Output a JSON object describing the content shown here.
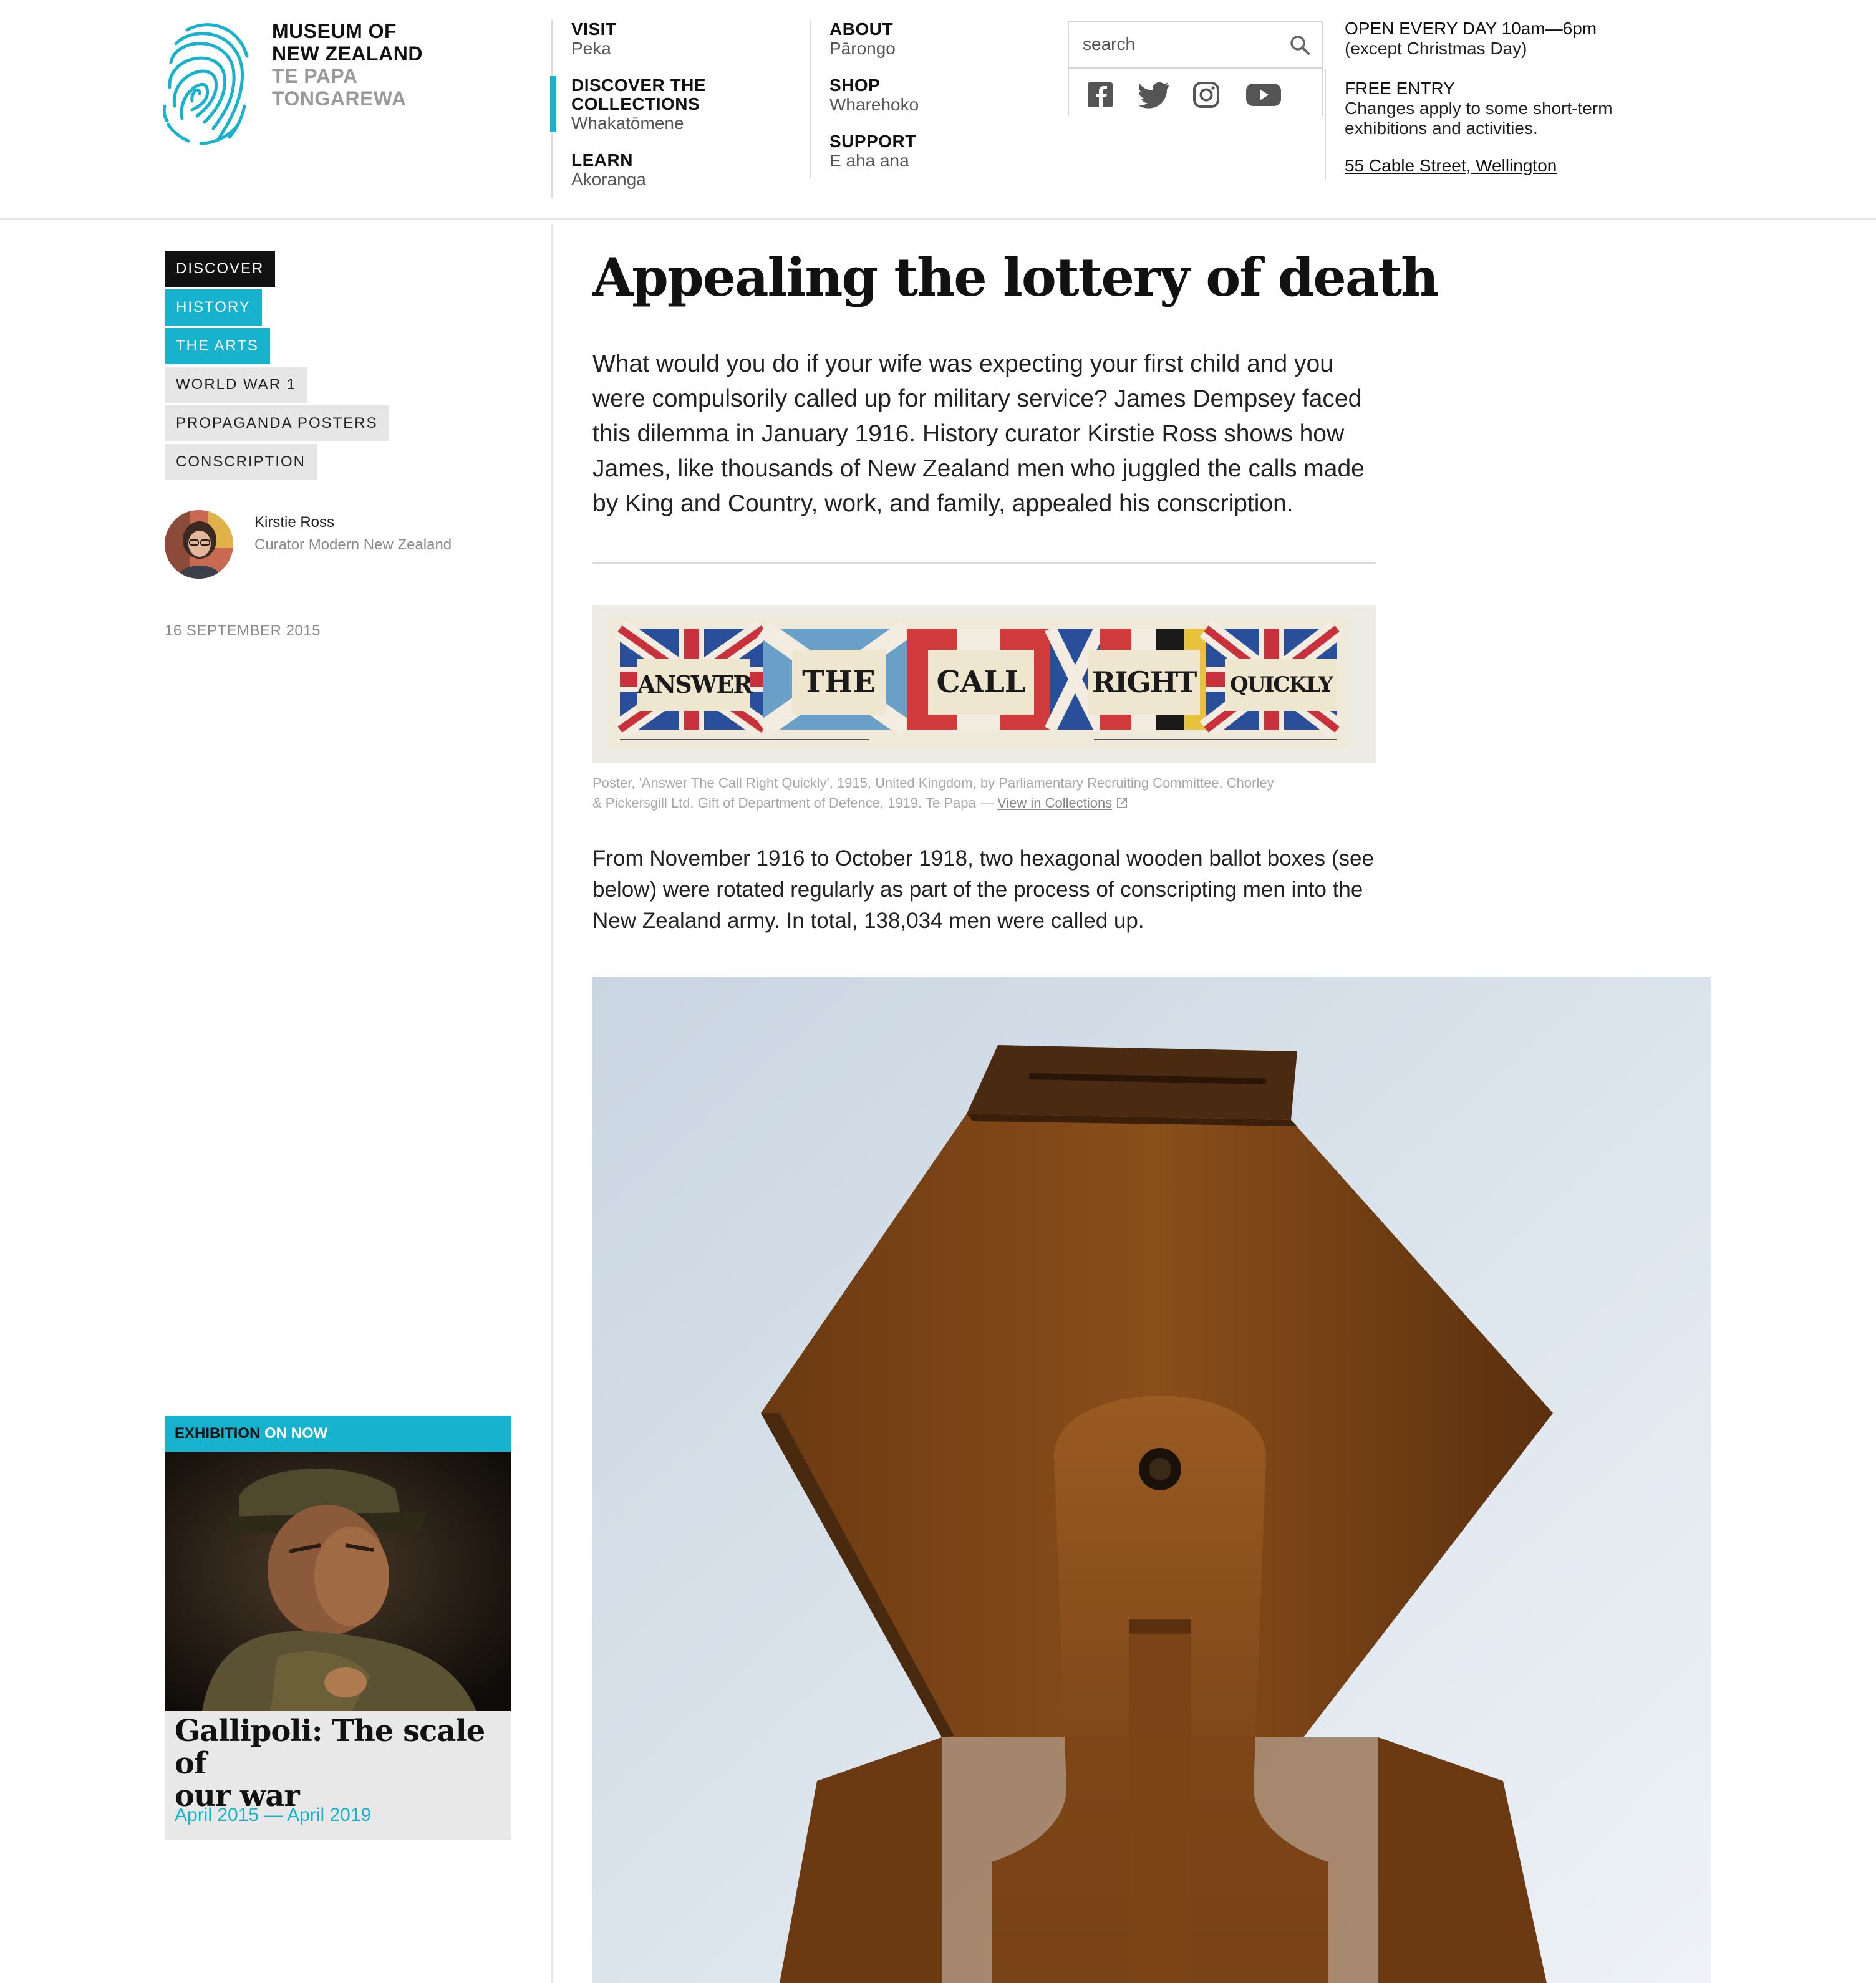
{
  "header": {
    "logo": {
      "line1": "MUSEUM OF",
      "line2": "NEW ZEALAND",
      "line3": "TE PAPA",
      "line4": "TONGAREWA"
    },
    "nav": [
      {
        "title": "VISIT",
        "sub": "Peka"
      },
      {
        "title_l1": "DISCOVER THE",
        "title_l2": "COLLECTIONS",
        "sub": "Whakatōmene",
        "active": true
      },
      {
        "title": "LEARN",
        "sub": "Akoranga"
      },
      {
        "title": "ABOUT",
        "sub": "Pārongo"
      },
      {
        "title": "SHOP",
        "sub": "Wharehoko"
      },
      {
        "title": "SUPPORT",
        "sub": "E aha ana"
      }
    ],
    "search": {
      "placeholder": "search"
    },
    "social": [
      "facebook-icon",
      "twitter-icon",
      "instagram-icon",
      "youtube-icon"
    ],
    "info": {
      "hours_l1": "OPEN EVERY DAY 10am—6pm",
      "hours_l2": "(except Christmas Day)",
      "entry_title": "FREE ENTRY",
      "entry_l1": "Changes apply to some short-term",
      "entry_l2": "exhibitions and activities.",
      "address": "55 Cable Street, Wellington"
    }
  },
  "sidebar": {
    "tags": [
      "DISCOVER",
      "HISTORY",
      "THE ARTS",
      "WORLD WAR 1",
      "PROPAGANDA POSTERS",
      "CONSCRIPTION"
    ],
    "author": {
      "name": "Kirstie Ross",
      "role": "Curator Modern New Zealand"
    },
    "date": "16 SEPTEMBER 2015",
    "promo": {
      "label_a": "EXHIBITION",
      "label_b": " ON NOW",
      "title_l1": "Gallipoli: The scale of",
      "title_l2": "our war",
      "dates": "April 2015 — April 2019"
    }
  },
  "article": {
    "title": "Appealing the  lottery of death",
    "lead": "What would you do if your wife was expecting your first child and you were compulsorily called up for military service? James Dempsey faced this dilemma in January 1916. History curator Kirstie Ross shows how James, like thousands of New Zealand men who juggled the calls made by King and Country, work, and family, appealed his conscription.",
    "poster_words": [
      "ANSWER",
      "THE",
      "CALL",
      "RIGHT",
      "QUICKLY"
    ],
    "caption_l1": "Poster, 'Answer The Call Right Quickly', 1915, United Kingdom, by Parliamentary Recruiting Committee, Chorley",
    "caption_l2": "& Pickersgill Ltd. Gift of Department of Defence, 1919. Te Papa — ",
    "caption_link": "View in Collections",
    "body": "From November 1916 to October 1918, two hexagonal wooden ballot boxes (see below) were rotated regularly as part of the process of conscripting men into the New Zealand army. In total, 138,034 men were called up."
  },
  "colors": {
    "accent": "#17b2cd",
    "dark": "#111111",
    "tag_grey": "#e6e6e6"
  }
}
